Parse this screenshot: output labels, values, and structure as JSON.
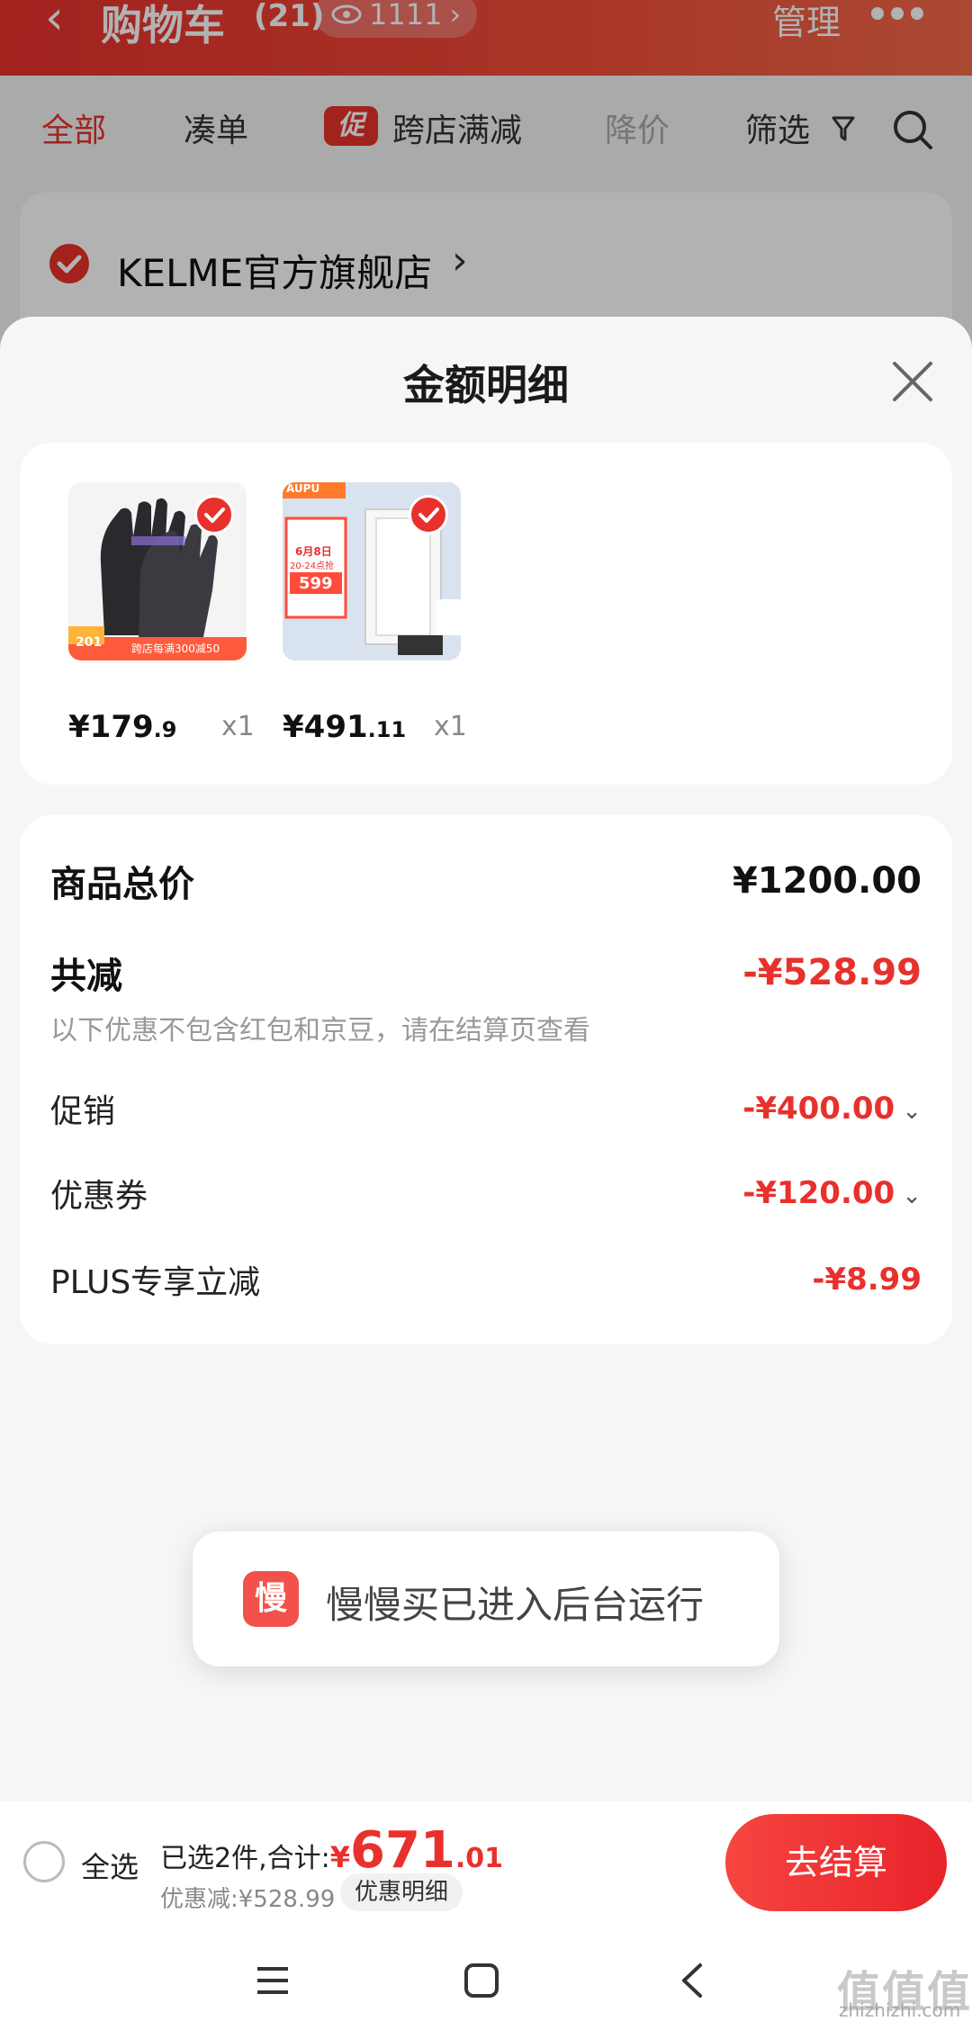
{
  "header": {
    "back_glyph": "‹",
    "title": "购物车",
    "count": "(21)",
    "views": "1111",
    "views_chevron": "›",
    "manage": "管理"
  },
  "filter_tabs": {
    "all": "全部",
    "bundle": "凑单",
    "promo_badge": "促",
    "cross_store": "跨店满减",
    "price_drop": "降价",
    "filter": "筛选"
  },
  "store": {
    "name": "KELME官方旗舰店",
    "chevron": "›"
  },
  "sheet": {
    "title": "金额明细"
  },
  "products": [
    {
      "price_main": "¥179",
      "price_frac": ".9",
      "qty": "x1"
    },
    {
      "price_main": "¥491",
      "price_frac": ".11",
      "qty": "x1"
    }
  ],
  "product_labels": {
    "p1_coupon_a": "201",
    "p1_coupon_b": "跨店每满300减50",
    "p2_brand": "AUPU",
    "p2_date": "6月8日",
    "p2_time": "20-24点抢",
    "p2_price": "599"
  },
  "totals": {
    "goods_total_label": "商品总价",
    "goods_total_value": "¥1200.00",
    "total_reduce_label": "共减",
    "total_reduce_value": "-¥528.99",
    "hint": "以下优惠不包含红包和京豆，请在结算页查看",
    "promo_label": "促销",
    "promo_value": "-¥400.00",
    "coupon_label": "优惠券",
    "coupon_value": "-¥120.00",
    "plus_label": "PLUS专享立减",
    "plus_value": "-¥8.99",
    "chevron": "⌄"
  },
  "toast": {
    "app_glyph": "慢",
    "message": "慢慢买已进入后台运行"
  },
  "checkout": {
    "select_all": "全选",
    "selected_prefix": "已选2件,合计:",
    "yen": "¥",
    "amount": "671",
    "cents": ".01",
    "discount": "优惠减:¥528.99",
    "detail_button": "优惠明细",
    "pay_button": "去结算"
  },
  "watermark": {
    "logo": "值值值",
    "site": "zhizhizhi.com"
  },
  "colors": {
    "accent": "#e8312c"
  }
}
